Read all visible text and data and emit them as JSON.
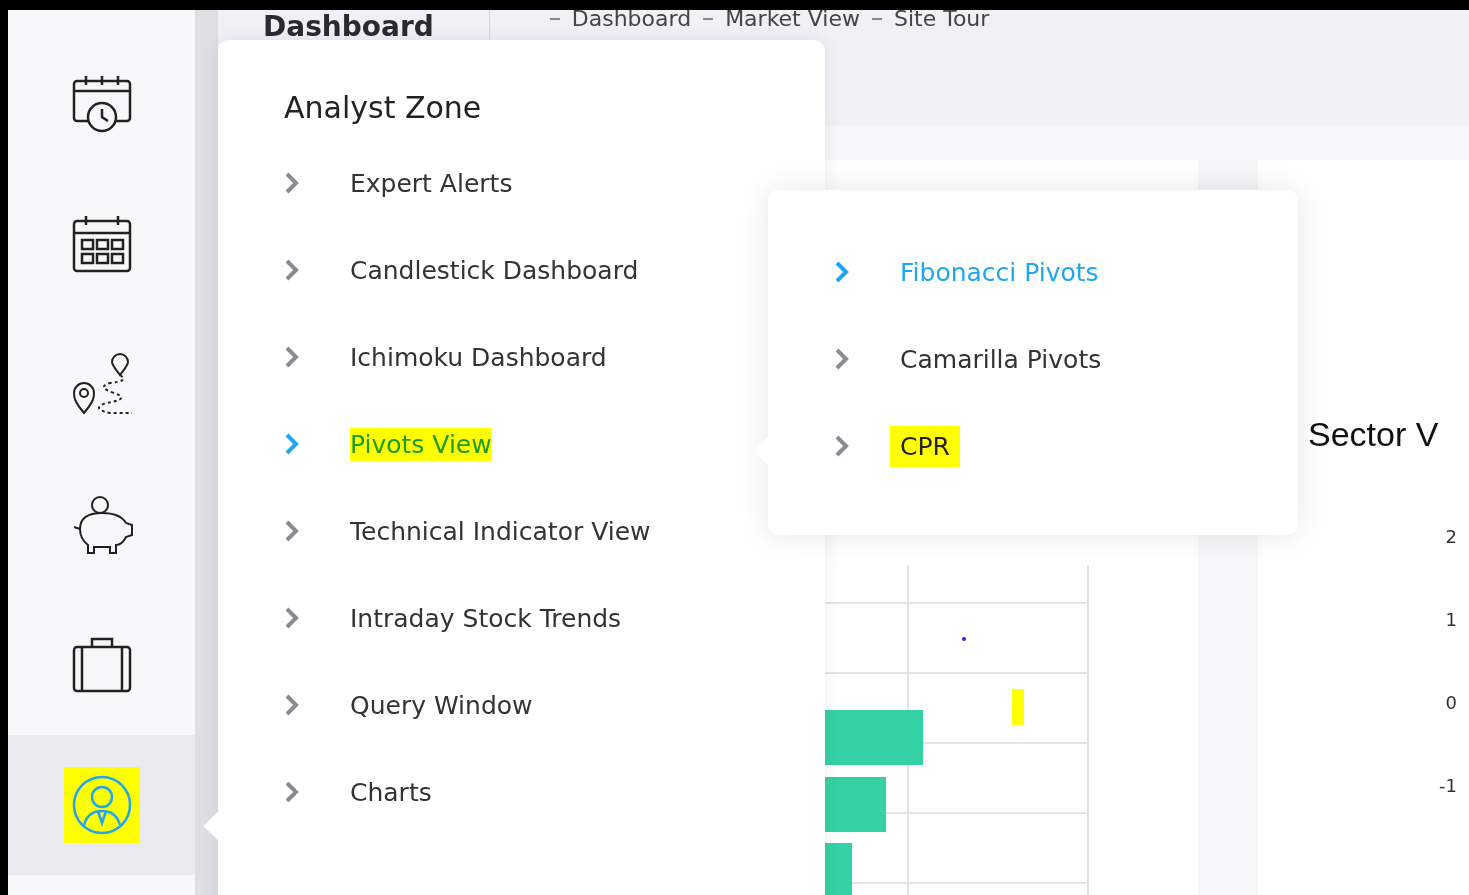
{
  "header": {
    "title": "Dashboard",
    "breadcrumb": [
      "Dashboard",
      "Market View",
      "Site Tour"
    ]
  },
  "sidebar": {
    "items": [
      {
        "kind": "schedule",
        "selected": false,
        "highlighted": false
      },
      {
        "kind": "calendar",
        "selected": false,
        "highlighted": false
      },
      {
        "kind": "route",
        "selected": false,
        "highlighted": false
      },
      {
        "kind": "savings",
        "selected": false,
        "highlighted": false
      },
      {
        "kind": "briefcase",
        "selected": false,
        "highlighted": false
      },
      {
        "kind": "analyst",
        "selected": true,
        "highlighted": true
      }
    ]
  },
  "menu": {
    "title": "Analyst Zone",
    "items": [
      {
        "label": "Expert Alerts",
        "selected": false,
        "highlighted": false
      },
      {
        "label": "Candlestick Dashboard",
        "selected": false,
        "highlighted": false
      },
      {
        "label": "Ichimoku Dashboard",
        "selected": false,
        "highlighted": false
      },
      {
        "label": "Pivots View",
        "selected": true,
        "highlighted": true
      },
      {
        "label": "Technical Indicator View",
        "selected": false,
        "highlighted": false
      },
      {
        "label": "Intraday Stock Trends",
        "selected": false,
        "highlighted": false
      },
      {
        "label": "Query Window",
        "selected": false,
        "highlighted": false
      },
      {
        "label": "Charts",
        "selected": false,
        "highlighted": false
      }
    ]
  },
  "submenu": {
    "items": [
      {
        "label": "Fibonacci Pivots",
        "selected": true,
        "highlighted": false
      },
      {
        "label": "Camarilla Pivots",
        "selected": false,
        "highlighted": false
      },
      {
        "label": "CPR",
        "selected": false,
        "highlighted": true
      }
    ]
  },
  "sector_card": {
    "title": "Sector V",
    "axis_ticks": [
      "2",
      "1",
      "0",
      "-1"
    ]
  }
}
